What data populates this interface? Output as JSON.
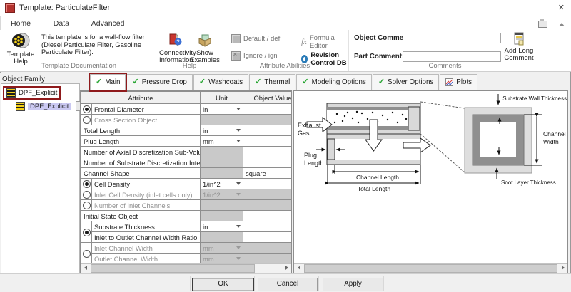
{
  "window": {
    "title": "Template: ParticulateFilter"
  },
  "icons": {
    "close": "✕",
    "check": "✓",
    "browse": "...",
    "formula": "fx"
  },
  "ribbon_tabs": {
    "items": [
      "Home",
      "Data",
      "Advanced"
    ],
    "active": "Home"
  },
  "ribbon": {
    "template_doc": {
      "button": "Template Help",
      "description": "This template is for a wall-flow filter (Diesel Particulate Filter, Gasoline Particulate Filter).",
      "section": "Template Documentation"
    },
    "help": {
      "connectivity": "Connectivity Information",
      "examples": "Show Examples",
      "section": "Help"
    },
    "abilities": {
      "default": "Default / def",
      "ignore": "Ignore / ign",
      "formula": "Formula Editor",
      "revision": "Revision Control DB",
      "section": "Attribute Abilities"
    },
    "comments": {
      "object_label": "Object Comment:",
      "part_label": "Part Comment:",
      "object_value": "",
      "part_value": "",
      "add_long": "Add Long Comment",
      "section": "Comments"
    }
  },
  "object_family": {
    "label": "Object Family",
    "root": "DPF_Explicit",
    "child": "DPF_Explicit"
  },
  "content_tabs": [
    {
      "label": "Main",
      "icon": "check",
      "annotated": true
    },
    {
      "label": "Pressure Drop",
      "icon": "check"
    },
    {
      "label": "Washcoats",
      "icon": "check"
    },
    {
      "label": "Thermal",
      "icon": "check"
    },
    {
      "label": "Modeling Options",
      "icon": "check"
    },
    {
      "label": "Solver Options",
      "icon": "check"
    },
    {
      "label": "Plots",
      "icon": "plots"
    }
  ],
  "table": {
    "headers": {
      "attribute": "Attribute",
      "unit": "Unit",
      "value": "Object Value"
    },
    "rows": [
      {
        "attribute": "Frontal Diameter",
        "unit": "in",
        "unit_dropdown": true,
        "value": "",
        "radio": "on",
        "disabled": false
      },
      {
        "attribute": "Cross Section Object",
        "unit": "",
        "unit_dropdown": false,
        "value": "",
        "radio": "off",
        "disabled": true
      },
      {
        "attribute": "Total Length",
        "unit": "in",
        "unit_dropdown": true,
        "value": "",
        "radio": null,
        "disabled": false
      },
      {
        "attribute": "Plug Length",
        "unit": "mm",
        "unit_dropdown": true,
        "value": "",
        "radio": null,
        "disabled": false
      },
      {
        "attribute": "Number of Axial Discretization Sub-Volumes",
        "unit": "",
        "unit_dropdown": false,
        "value": "",
        "radio": null,
        "disabled": false
      },
      {
        "attribute": "Number of Substrate Discretization Intervals",
        "unit": "",
        "unit_dropdown": false,
        "value": "",
        "radio": null,
        "disabled": false
      },
      {
        "attribute": "Channel Shape",
        "unit": "",
        "unit_dropdown": false,
        "value": "square",
        "radio": null,
        "disabled": false
      },
      {
        "attribute": "Cell Density",
        "unit": "1/in^2",
        "unit_dropdown": true,
        "value": "",
        "radio": "on",
        "disabled": false
      },
      {
        "attribute": "Inlet Cell Density (inlet cells only)",
        "unit": "1/in^2",
        "unit_dropdown": true,
        "value": "",
        "radio": "off",
        "disabled": true
      },
      {
        "attribute": "Number of Inlet Channels",
        "unit": "",
        "unit_dropdown": false,
        "value": "",
        "radio": "off",
        "disabled": true
      },
      {
        "attribute": "Initial State Object",
        "unit": "",
        "unit_dropdown": false,
        "value": "",
        "radio": null,
        "disabled": false
      },
      {
        "attribute": "Substrate Thickness",
        "unit": "in",
        "unit_dropdown": true,
        "value": "",
        "radio": "on",
        "rowspan": 2,
        "disabled": false
      },
      {
        "attribute": "Inlet to Outlet Channel Width Ratio",
        "unit": "",
        "unit_dropdown": false,
        "value": "",
        "merged": true,
        "disabled": false
      },
      {
        "attribute": "Inlet Channel Width",
        "unit": "mm",
        "unit_dropdown": true,
        "value": "",
        "radio": "off",
        "rowspan": 2,
        "disabled": true
      },
      {
        "attribute": "Outlet Channel Width",
        "unit": "mm",
        "unit_dropdown": true,
        "value": "",
        "merged": true,
        "disabled": true
      }
    ]
  },
  "diagram": {
    "exhaust_gas": [
      "Exhaust",
      "Gas"
    ],
    "plug_length": [
      "Plug",
      "Length"
    ],
    "channel_length": "Channel Length",
    "total_length": "Total Length",
    "substrate_wall_thickness": "Substrate Wall Thickness",
    "channel_width": [
      "Channel",
      "Width"
    ],
    "soot_layer_thickness": "Soot Layer Thickness"
  },
  "footer": {
    "ok": "OK",
    "cancel": "Cancel",
    "apply": "Apply"
  },
  "colors": {
    "annotation": "#8f1a1c",
    "check_green": "#27a532",
    "disabled_bg": "#c9c9c9",
    "soot_gray": "#8f8f8f",
    "substrate_gray": "#d9d9d9"
  }
}
